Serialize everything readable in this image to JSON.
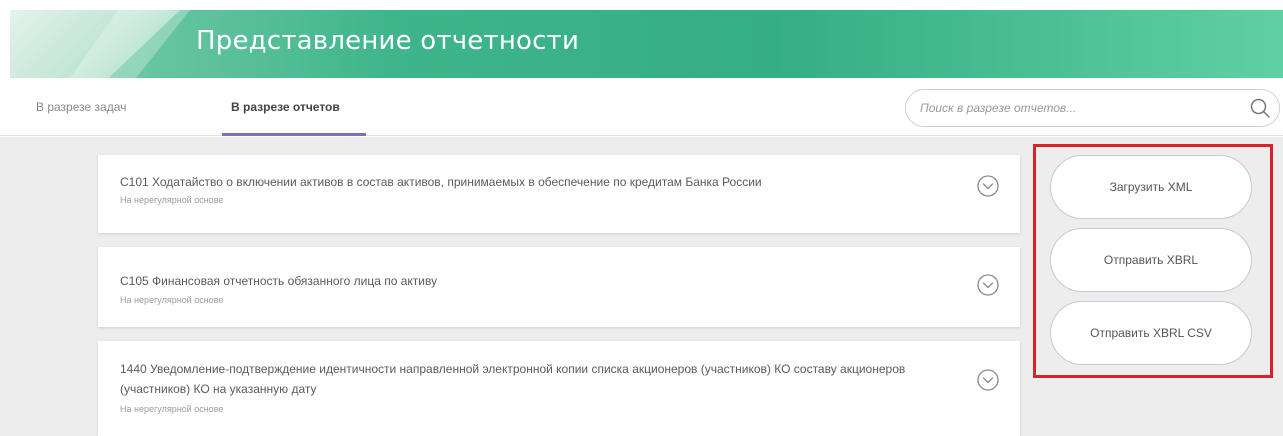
{
  "header": {
    "title": "Представление отчетности"
  },
  "tabs": [
    {
      "label": "В разрезе задач"
    },
    {
      "label": "В разрезе отчетов"
    }
  ],
  "search": {
    "placeholder": "Поиск в разрезе отчетов..."
  },
  "reports": [
    {
      "title": "С101 Ходатайство о включении активов в состав активов, принимаемых в обеспечение по кредитам Банка России",
      "frequency": "На нерегулярной основе"
    },
    {
      "title": "С105 Финансовая отчетность обязанного лица по активу",
      "frequency": "На нерегулярной основе"
    },
    {
      "title": "1440 Уведомление-подтверждение идентичности направленной электронной копии списка акционеров (участников) КО составу акционеров (участников) КО на указанную дату",
      "frequency": "На нерегулярной основе"
    }
  ],
  "actions": {
    "upload_xml": "Загрузить XML",
    "send_xbrl": "Отправить XBRL",
    "send_xbrl_csv": "Отправить XBRL CSV"
  },
  "icons": {
    "search": "search-icon",
    "expand": "chevron-down-circle-icon"
  },
  "colors": {
    "banner": "#3fb58c",
    "tab_underline": "#7d6fb8",
    "highlight": "#d8232a"
  }
}
